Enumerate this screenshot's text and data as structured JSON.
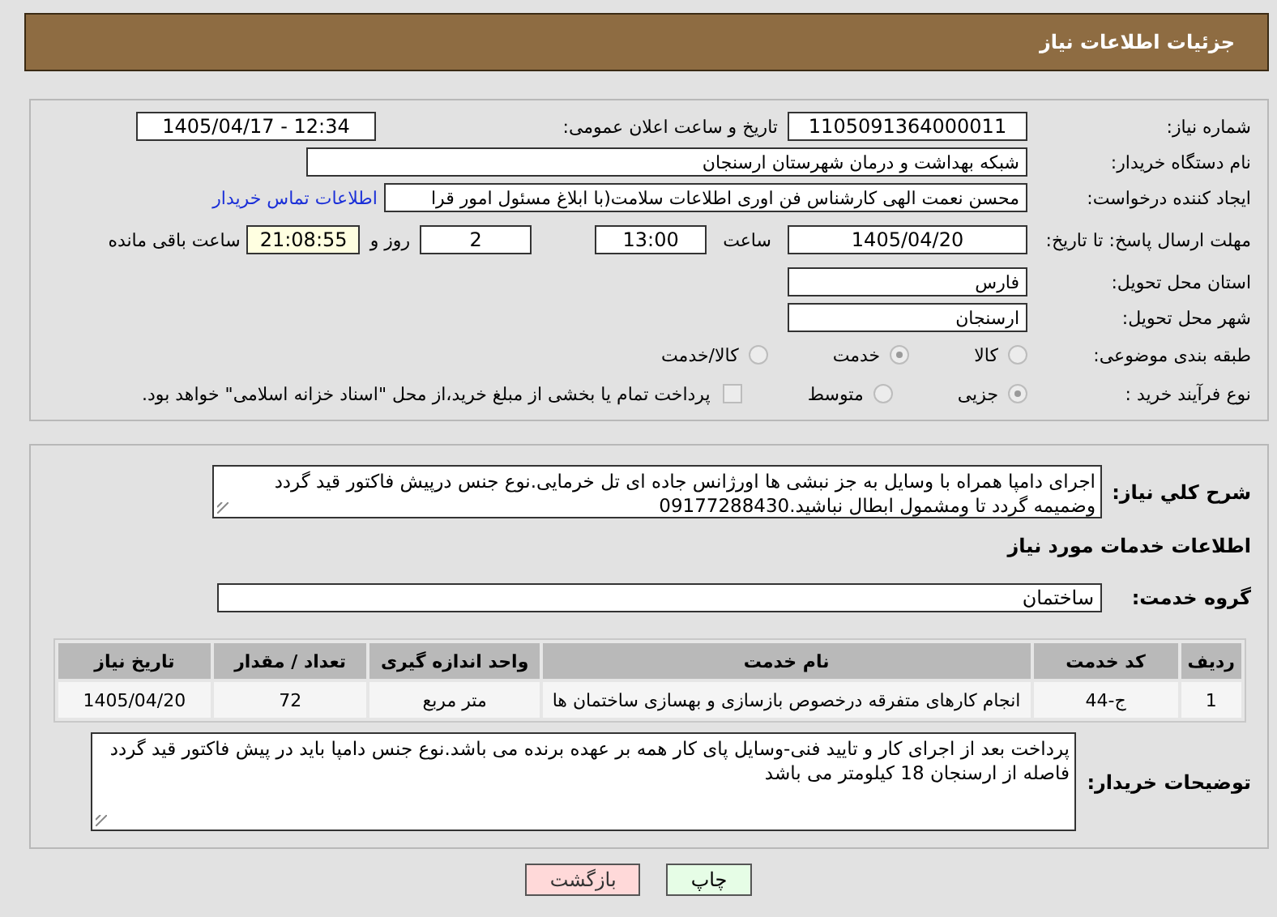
{
  "header": {
    "title": "جزئیات اطلاعات نیاز"
  },
  "need_number": {
    "label": "شماره نیاز:",
    "value": "1105091364000011"
  },
  "announce": {
    "label": "تاریخ و ساعت اعلان عمومی:",
    "value": "1405/04/17 - 12:34"
  },
  "buyer_org": {
    "label": "نام دستگاه خریدار:",
    "value": "شبکه بهداشت و درمان شهرستان ارسنجان"
  },
  "requester": {
    "label": "ایجاد کننده درخواست:",
    "value": "محسن نعمت الهی کارشناس فن اوری اطلاعات سلامت(با ابلاغ مسئول امور قرا",
    "link": "اطلاعات تماس خریدار"
  },
  "deadline": {
    "label": "مهلت ارسال پاسخ: تا تاریخ:",
    "date": "1405/04/20",
    "time_label": "ساعت",
    "time": "13:00",
    "days": "2",
    "days_label": "روز و",
    "remaining": "21:08:55",
    "remaining_label": "ساعت باقی مانده"
  },
  "province": {
    "label": "استان محل تحویل:",
    "value": "فارس"
  },
  "city": {
    "label": "شهر محل تحویل:",
    "value": "ارسنجان"
  },
  "category": {
    "label": "طبقه بندی موضوعی:",
    "options": [
      {
        "label": "کالا",
        "selected": false
      },
      {
        "label": "خدمت",
        "selected": true
      },
      {
        "label": "کالا/خدمت",
        "selected": false
      }
    ]
  },
  "process": {
    "label": "نوع فرآیند خرید :",
    "options": [
      {
        "label": "جزیی",
        "selected": true
      },
      {
        "label": "متوسط",
        "selected": false
      }
    ],
    "payment": {
      "label": "پرداخت تمام یا بخشی از مبلغ خرید،از محل \"اسناد خزانه اسلامی\" خواهد بود.",
      "checked": false
    }
  },
  "description": {
    "label": "شرح کلي نیاز:",
    "value": "اجرای دامپا همراه با وسایل به جز نبشی ها اورژانس جاده ای تل خرمایی.نوع جنس درپیش فاکتور قید گردد وضمیمه گردد تا ومشمول ابطال نباشید.09177288430"
  },
  "services_heading": "اطلاعات خدمات مورد نیاز",
  "service_group": {
    "label": "گروه خدمت:",
    "value": "ساختمان"
  },
  "table": {
    "columns": [
      "ردیف",
      "کد خدمت",
      "نام خدمت",
      "واحد اندازه گیری",
      "تعداد / مقدار",
      "تاریخ نیاز"
    ],
    "rows": [
      [
        "1",
        "ج-44",
        "انجام کارهای متفرقه درخصوص بازسازی و بهسازی ساختمان ها",
        "متر مربع",
        "72",
        "1405/04/20"
      ]
    ]
  },
  "buyer_notes": {
    "label": "توضیحات خریدار:",
    "value": "پرداخت بعد از اجرای کار و تایید فنی-وسایل پای کار همه بر عهده برنده می باشد.نوع جنس دامپا باید در پیش فاکتور قید گردد فاصله از ارسنجان 18 کیلومتر می باشد"
  },
  "buttons": [
    {
      "label": "چاپ",
      "kind": "print"
    },
    {
      "label": "بازگشت",
      "kind": "back"
    }
  ]
}
